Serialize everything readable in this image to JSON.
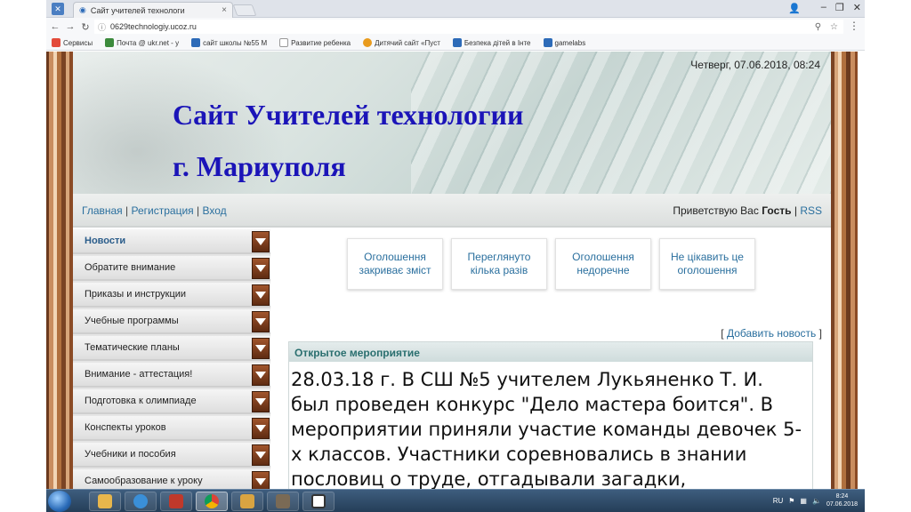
{
  "browser": {
    "tab_title": "Сайт учителей технологи",
    "tab_close": "×",
    "url": "0629technologiy.ucoz.ru",
    "win_minimize": "–",
    "win_restore": "❐",
    "win_close": "✕",
    "bookmarks": [
      {
        "label": "Сервисы",
        "color": "#e34b3a"
      },
      {
        "label": "Почта @ ukr.net - у",
        "color": "#3c8a3c"
      },
      {
        "label": "сайт школы №55 М",
        "color": "#2d6bb8"
      },
      {
        "label": "Развитие ребенка",
        "color": "#d0d0d0"
      },
      {
        "label": "Дитячий сайт «Пуст",
        "color": "#e99b1d"
      },
      {
        "label": "Безпека дітей в Інте",
        "color": "#2d6bb8"
      },
      {
        "label": "gamelabs",
        "color": "#2d6bb8"
      }
    ]
  },
  "header": {
    "datetime": "Четверг, 07.06.2018, 08:24",
    "title_line1": "Сайт Учителей технологии",
    "title_line2": "г. Мариуполя"
  },
  "nav": {
    "home": "Главная",
    "register": "Регистрация",
    "login": "Вход",
    "greeting": "Приветствую Вас",
    "user": "Гость",
    "rss": "RSS",
    "sep": "|"
  },
  "sidebar": {
    "items": [
      "Новости",
      "Обратите внимание",
      "Приказы и инструкции",
      "Учебные программы",
      "Тематические планы",
      "Внимание - аттестация!",
      "Подготовка к олимпиаде",
      "Конспекты уроков",
      "Учебники и пособия",
      "Самообразование к уроку"
    ]
  },
  "ads": [
    "Оголошення закриває зміст",
    "Переглянуто кілька разів",
    "Оголошення недоречне",
    "Не цікавить це оголошення"
  ],
  "main": {
    "add_news_open": "[",
    "add_news": "Добавить новость",
    "add_news_close": "]",
    "news_title": "Открытое мероприятие",
    "news_body": "28.03.18 г. В СШ №5 учителем Лукьяненко Т. И. был проведен конкурс \"Дело мастера боится\". В мероприятии приняли участие команды девочек 5-х классов. Участники соревновались в знании пословиц о труде, отгадывали загадки,"
  },
  "taskbar": {
    "lang": "RU",
    "time": "8:24",
    "date": "07.06.2018"
  }
}
